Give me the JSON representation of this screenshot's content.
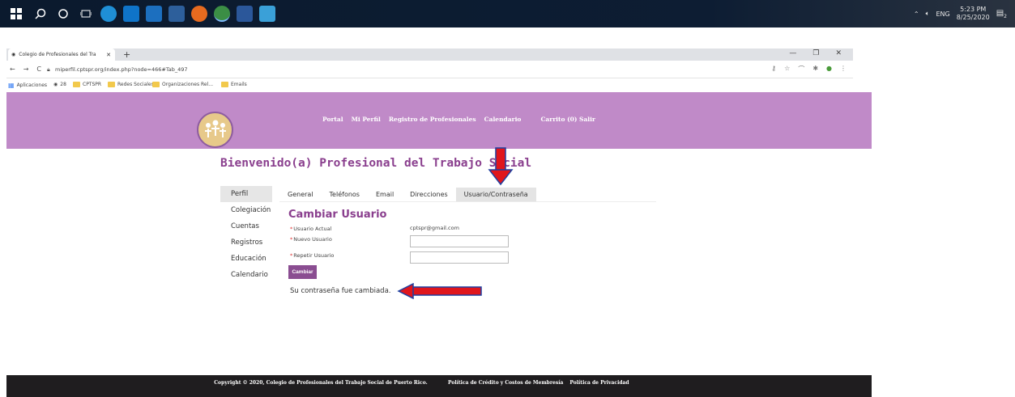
{
  "taskbar": {
    "clock_time": "5:23 PM",
    "clock_date": "8/25/2020",
    "lang": "ENG",
    "notification_count": "2"
  },
  "browser": {
    "tab_title": "Colegio de Profesionales del Tra",
    "url": "miperfil.cptspr.org/index.php?node=466#Tab_497",
    "bookmarks": [
      {
        "label": "Aplicaciones"
      },
      {
        "label": "28"
      },
      {
        "label": "CPTSPR"
      },
      {
        "label": "Redes Sociales"
      },
      {
        "label": "Organizaciones Rel..."
      },
      {
        "label": "Emails"
      }
    ]
  },
  "nav": {
    "items": [
      "Portal",
      "Mi Perfil",
      "Registro de Profesionales",
      "Calendario",
      "Carrito (0) Salir"
    ]
  },
  "page": {
    "welcome": "Bienvenido(a) Profesional del Trabajo Social"
  },
  "sidebar": {
    "items": [
      "Perfil",
      "Colegiación",
      "Cuentas",
      "Registros",
      "Educación",
      "Calendario"
    ]
  },
  "subtabs": {
    "items": [
      "General",
      "Teléfonos",
      "Email",
      "Direcciones",
      "Usuario/Contraseña"
    ]
  },
  "form": {
    "title": "Cambiar Usuario",
    "current_user_label": "Usuario Actual",
    "current_user_value": "cptspr@gmail.com",
    "new_user_label": "Nuevo Usuario",
    "repeat_user_label": "Repetir Usuario",
    "required_mark": "*",
    "submit_label": "Cambiar",
    "message": "Su contraseña fue cambiada."
  },
  "footer": {
    "copyright": "Copyright © 2020, Colegio de Profesionales del Trabajo Social de Puerto Rico.",
    "link1": "Política de Crédito y Costos de Membresía",
    "link2": "Política de Privacidad"
  },
  "colors": {
    "header": "#c08ac8",
    "accent": "#8a3f8e",
    "button": "#8a4d91",
    "annotation_red": "#e0161c",
    "annotation_blue": "#1f3fa0"
  }
}
